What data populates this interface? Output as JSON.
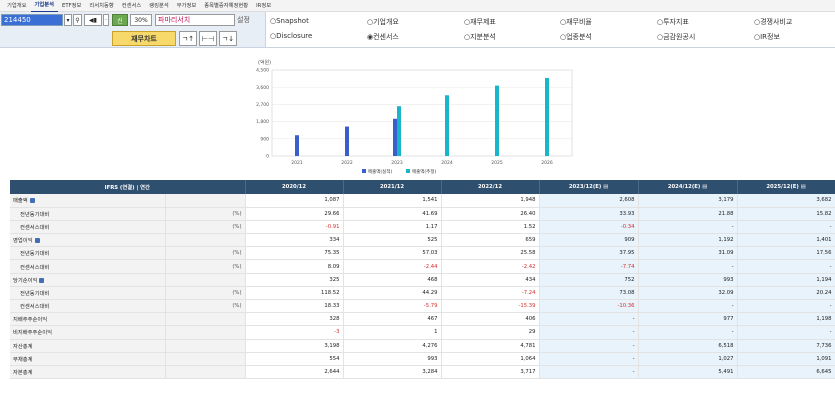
{
  "nav": [
    "기업개요",
    "기업분석",
    "ETF정보",
    "리서치동향",
    "컨센서스",
    "랭킹분석",
    "부가정보",
    "종목별증자예정현황",
    "IR정보"
  ],
  "toolbar": {
    "code": "214450",
    "btn_new": "신",
    "btn_30": "30%",
    "company": "파마리서치",
    "company_suffix": "설정",
    "chart_btn": "재무차트"
  },
  "radios": [
    {
      "label": "Snapshot",
      "checked": false
    },
    {
      "label": "기업개요",
      "checked": false
    },
    {
      "label": "재무제표",
      "checked": false
    },
    {
      "label": "재무비율",
      "checked": false
    },
    {
      "label": "투자지표",
      "checked": false
    },
    {
      "label": "경쟁사비교",
      "checked": false
    },
    {
      "label": "Disclosure",
      "checked": false
    },
    {
      "label": "컨센서스",
      "checked": true
    },
    {
      "label": "지분분석",
      "checked": false
    },
    {
      "label": "업종분석",
      "checked": false
    },
    {
      "label": "금감원공시",
      "checked": false
    },
    {
      "label": "IR정보",
      "checked": false
    }
  ],
  "chart_data": {
    "type": "bar",
    "unit_label": "(억원)",
    "categories": [
      "2021",
      "2022",
      "2023",
      "2024",
      "2025",
      "2026"
    ],
    "series": [
      {
        "name": "매출액(실적)",
        "color": "#3a5fcd",
        "values": [
          1087,
          1541,
          1948,
          null,
          null,
          null
        ]
      },
      {
        "name": "매출액(추정)",
        "color": "#18b6c8",
        "values": [
          null,
          null,
          2608,
          3179,
          3682,
          4080
        ]
      }
    ],
    "ylim": [
      0,
      4500
    ],
    "yticks": [
      "4,500",
      "3,600",
      "2,700",
      "1,800",
      "900",
      "0"
    ]
  },
  "table": {
    "header_label": "IFRS (연결) | 연간",
    "columns": [
      "2020/12",
      "2021/12",
      "2022/12",
      "2023/12(E)",
      "2024/12(E)",
      "2025/12(E)"
    ],
    "estimate_flags": [
      false,
      false,
      false,
      true,
      true,
      true
    ],
    "rows": [
      {
        "label": "매출액",
        "expand": true,
        "sub": false,
        "unit": "",
        "values": [
          "1,087",
          "1,541",
          "1,948",
          "2,608",
          "3,179",
          "3,682"
        ]
      },
      {
        "label": "전년동기대비",
        "expand": false,
        "sub": true,
        "unit": "(%)",
        "values": [
          "29.66",
          "41.69",
          "26.40",
          "33.93",
          "21.88",
          "15.82"
        ]
      },
      {
        "label": "컨센서스대비",
        "expand": false,
        "sub": true,
        "unit": "(%)",
        "values": [
          "-0.91",
          "1.17",
          "1.52",
          "-0.34",
          "-",
          "-"
        ]
      },
      {
        "label": "영업이익",
        "expand": true,
        "sub": false,
        "unit": "",
        "values": [
          "334",
          "525",
          "659",
          "909",
          "1,192",
          "1,401"
        ]
      },
      {
        "label": "전년동기대비",
        "expand": false,
        "sub": true,
        "unit": "(%)",
        "values": [
          "75.35",
          "57.03",
          "25.58",
          "37.95",
          "31.09",
          "17.56"
        ]
      },
      {
        "label": "컨센서스대비",
        "expand": false,
        "sub": true,
        "unit": "(%)",
        "values": [
          "8.09",
          "-2.44",
          "-2.42",
          "-7.74",
          "-",
          "-"
        ]
      },
      {
        "label": "당기순이익",
        "expand": true,
        "sub": false,
        "unit": "",
        "values": [
          "325",
          "468",
          "434",
          "752",
          "993",
          "1,194"
        ]
      },
      {
        "label": "전년동기대비",
        "expand": false,
        "sub": true,
        "unit": "(%)",
        "values": [
          "118.52",
          "44.29",
          "-7.24",
          "73.08",
          "32.09",
          "20.24"
        ]
      },
      {
        "label": "컨센서스대비",
        "expand": false,
        "sub": true,
        "unit": "(%)",
        "values": [
          "18.33",
          "-5.79",
          "-15.39",
          "-10.36",
          "-",
          "-"
        ]
      },
      {
        "label": "지배주주순이익",
        "expand": false,
        "sub": false,
        "unit": "",
        "values": [
          "328",
          "467",
          "406",
          "-",
          "977",
          "1,198"
        ]
      },
      {
        "label": "비지배주주순이익",
        "expand": false,
        "sub": false,
        "unit": "",
        "values": [
          "-3",
          "1",
          "29",
          "-",
          "-",
          "-"
        ]
      },
      {
        "label": "자산총계",
        "expand": false,
        "sub": false,
        "unit": "",
        "values": [
          "3,198",
          "4,276",
          "4,781",
          "-",
          "6,518",
          "7,736"
        ]
      },
      {
        "label": "부채총계",
        "expand": false,
        "sub": false,
        "unit": "",
        "values": [
          "554",
          "993",
          "1,064",
          "-",
          "1,027",
          "1,091"
        ]
      },
      {
        "label": "자본총계",
        "expand": false,
        "sub": false,
        "unit": "",
        "values": [
          "2,644",
          "3,284",
          "3,717",
          "-",
          "5,491",
          "6,645"
        ]
      }
    ]
  }
}
